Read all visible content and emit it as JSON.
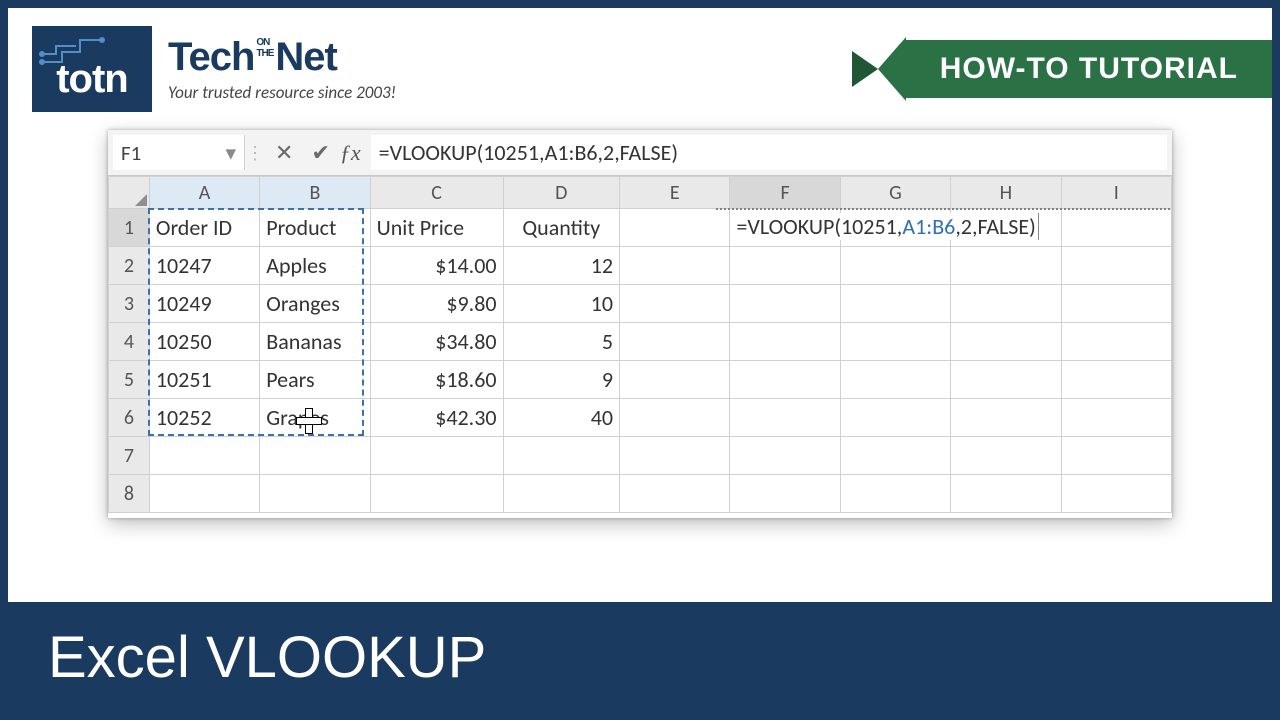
{
  "brand": {
    "logo_abbrev": "totn",
    "line1_a": "Tech",
    "line1_on": "ON",
    "line1_the": "THE",
    "line1_b": "Net",
    "tagline": "Your trusted resource since 2003!"
  },
  "ribbon": {
    "label": "HOW-TO TUTORIAL"
  },
  "namebox": {
    "value": "F1"
  },
  "formula_bar": {
    "value": "=VLOOKUP(10251,A1:B6,2,FALSE)"
  },
  "columns": [
    "A",
    "B",
    "C",
    "D",
    "E",
    "F",
    "G",
    "H",
    "I"
  ],
  "row_numbers": [
    "1",
    "2",
    "3",
    "4",
    "5",
    "6",
    "7",
    "8"
  ],
  "grid": {
    "r1": {
      "A": "Order ID",
      "B": "Product",
      "C": "Unit Price",
      "D": "Quantity"
    },
    "r2": {
      "A": "10247",
      "B": "Apples",
      "C": "$14.00",
      "D": "12"
    },
    "r3": {
      "A": "10249",
      "B": "Oranges",
      "C": "$9.80",
      "D": "10"
    },
    "r4": {
      "A": "10250",
      "B": "Bananas",
      "C": "$34.80",
      "D": "5"
    },
    "r5": {
      "A": "10251",
      "B": "Pears",
      "C": "$18.60",
      "D": "9"
    },
    "r6": {
      "A": "10252",
      "B": "Grapes",
      "C": "$42.30",
      "D": "40"
    }
  },
  "f1_formula": {
    "p1": "=VLOOKUP(10251,",
    "ref": "A1:B6",
    "p2": ",2,FALSE)"
  },
  "footer": {
    "title": "Excel VLOOKUP"
  }
}
